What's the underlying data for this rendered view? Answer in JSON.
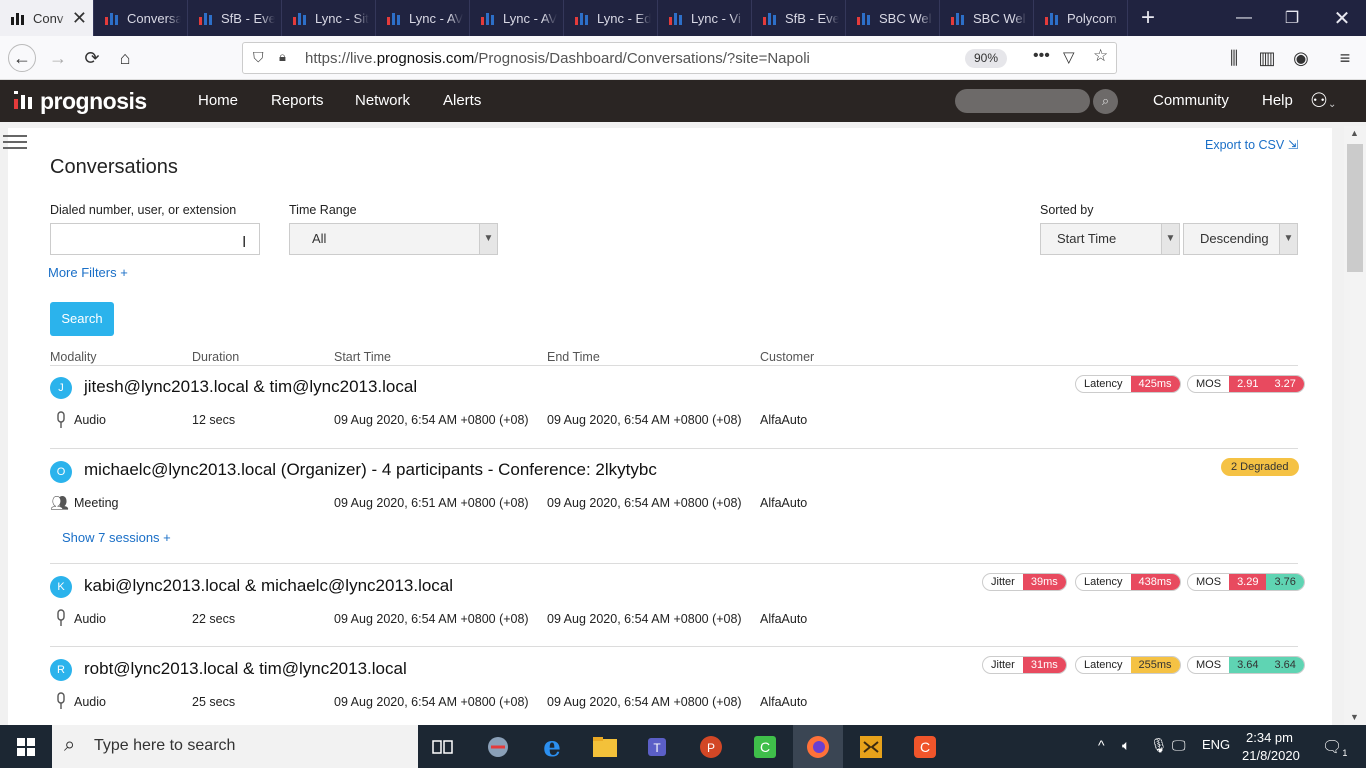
{
  "browser": {
    "tabs": [
      {
        "label": "Conv",
        "active": true
      },
      {
        "label": "Conversa"
      },
      {
        "label": "SfB - Eve"
      },
      {
        "label": "Lync - Sit"
      },
      {
        "label": "Lync - AV"
      },
      {
        "label": "Lync - AV"
      },
      {
        "label": "Lync - Ed"
      },
      {
        "label": "Lync - Vi"
      },
      {
        "label": "SfB - Eve"
      },
      {
        "label": "SBC Wel"
      },
      {
        "label": "SBC Wel"
      },
      {
        "label": "Polycom"
      }
    ],
    "url_prefix": "https://live.",
    "url_domain": "prognosis.com",
    "url_path": "/Prognosis/Dashboard/Conversations/?site=Napoli",
    "zoom": "90%"
  },
  "header": {
    "brand": "prognosis",
    "menu": [
      "Home",
      "Reports",
      "Network",
      "Alerts"
    ],
    "community": "Community",
    "help": "Help"
  },
  "page": {
    "title": "Conversations",
    "export_label": "Export to CSV",
    "filters": {
      "dialed_label": "Dialed number, user, or extension",
      "dialed_value": "",
      "time_range_label": "Time Range",
      "time_range_value": "All",
      "sorted_by_label": "Sorted by",
      "sort_field": "Start Time",
      "sort_order": "Descending",
      "more_filters": "More Filters +",
      "search_button": "Search"
    },
    "columns": [
      "Modality",
      "Duration",
      "Start Time",
      "End Time",
      "Customer"
    ],
    "conversations": [
      {
        "initial": "J",
        "title": "jitesh@lync2013.local & tim@lync2013.local",
        "modality": "Audio",
        "duration": "12 secs",
        "start": "09 Aug 2020, 6:54 AM +0800 (+08)",
        "end": "09 Aug 2020, 6:54 AM +0800 (+08)",
        "customer": "AlfaAuto",
        "latency": {
          "label": "Latency",
          "value": "425ms"
        },
        "mos": {
          "label": "MOS",
          "a": "2.91",
          "b": "3.27"
        }
      },
      {
        "initial": "O",
        "title": "michaelc@lync2013.local (Organizer) - 4 participants - Conference: 2lkytybc",
        "modality": "Meeting",
        "duration": "",
        "start": "09 Aug 2020, 6:51 AM +0800 (+08)",
        "end": "09 Aug 2020, 6:54 AM +0800 (+08)",
        "customer": "AlfaAuto",
        "degraded": "2 Degraded",
        "show_sessions": "Show 7 sessions +"
      },
      {
        "initial": "K",
        "title": "kabi@lync2013.local & michaelc@lync2013.local",
        "modality": "Audio",
        "duration": "22 secs",
        "start": "09 Aug 2020, 6:54 AM +0800 (+08)",
        "end": "09 Aug 2020, 6:54 AM +0800 (+08)",
        "customer": "AlfaAuto",
        "jitter": {
          "label": "Jitter",
          "value": "39ms"
        },
        "latency": {
          "label": "Latency",
          "value": "438ms"
        },
        "mos": {
          "label": "MOS",
          "a": "3.29",
          "b": "3.76"
        }
      },
      {
        "initial": "R",
        "title": "robt@lync2013.local & tim@lync2013.local",
        "modality": "Audio",
        "duration": "25 secs",
        "start": "09 Aug 2020, 6:54 AM +0800 (+08)",
        "end": "09 Aug 2020, 6:54 AM +0800 (+08)",
        "customer": "AlfaAuto",
        "jitter": {
          "label": "Jitter",
          "value": "31ms"
        },
        "latency": {
          "label": "Latency",
          "value": "255ms"
        },
        "mos": {
          "label": "MOS",
          "a": "3.64",
          "b": "3.64"
        }
      }
    ]
  },
  "taskbar": {
    "search_placeholder": "Type here to search",
    "lang": "ENG",
    "time": "2:34 pm",
    "date": "21/8/2020",
    "notifications": "1"
  }
}
